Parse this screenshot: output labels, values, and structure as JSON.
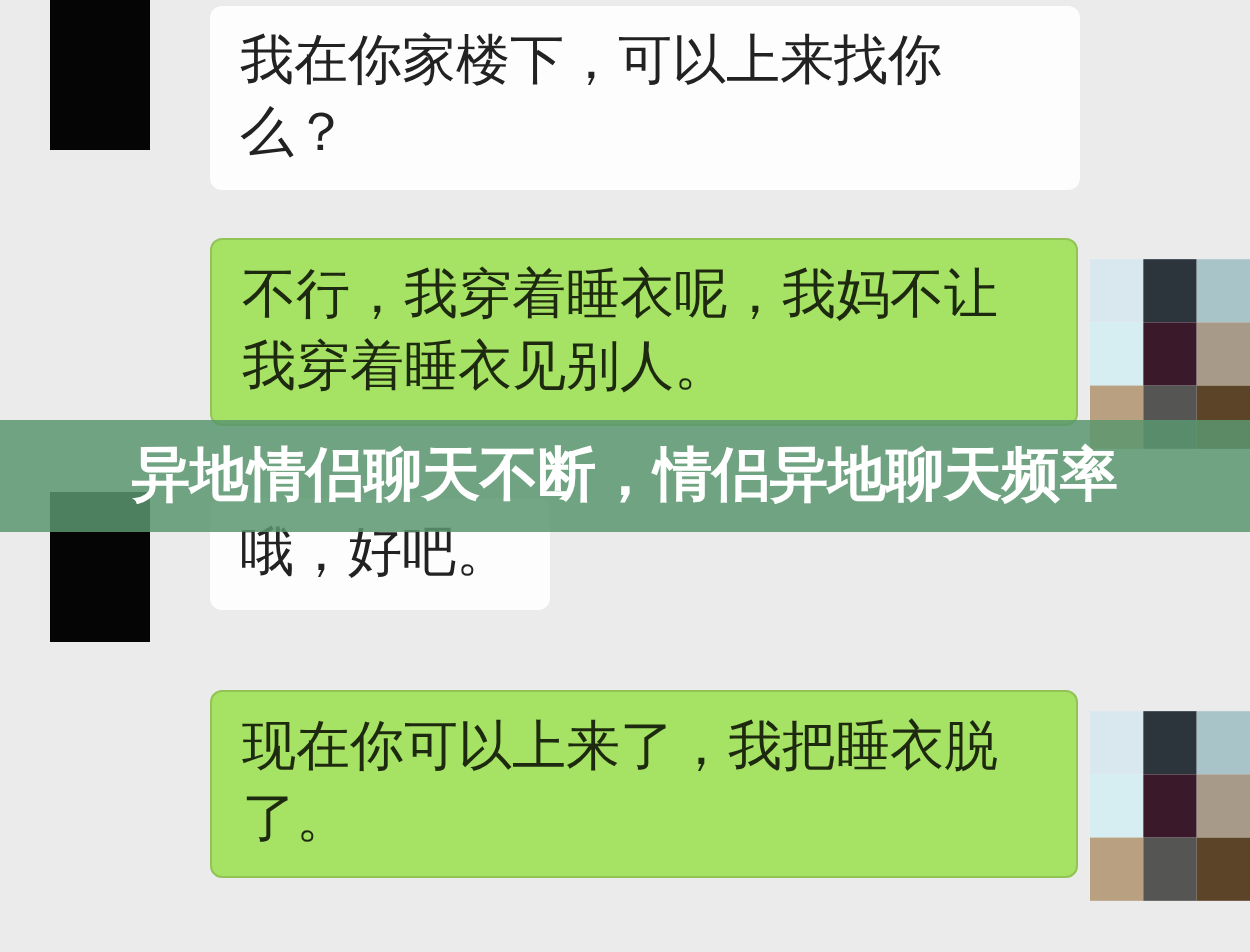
{
  "messages": [
    {
      "kind": "incoming",
      "text": "我在你家楼下，可以上来找你么？"
    },
    {
      "kind": "outgoing",
      "text": "不行，我穿着睡衣呢，我妈不让我穿着睡衣见别人。"
    },
    {
      "kind": "incoming",
      "text": "哦，好吧。"
    },
    {
      "kind": "outgoing",
      "text": "现在你可以上来了，我把睡衣脱了。"
    }
  ],
  "banner": {
    "title": "异地情侣聊天不断，情侣异地聊天频率"
  }
}
